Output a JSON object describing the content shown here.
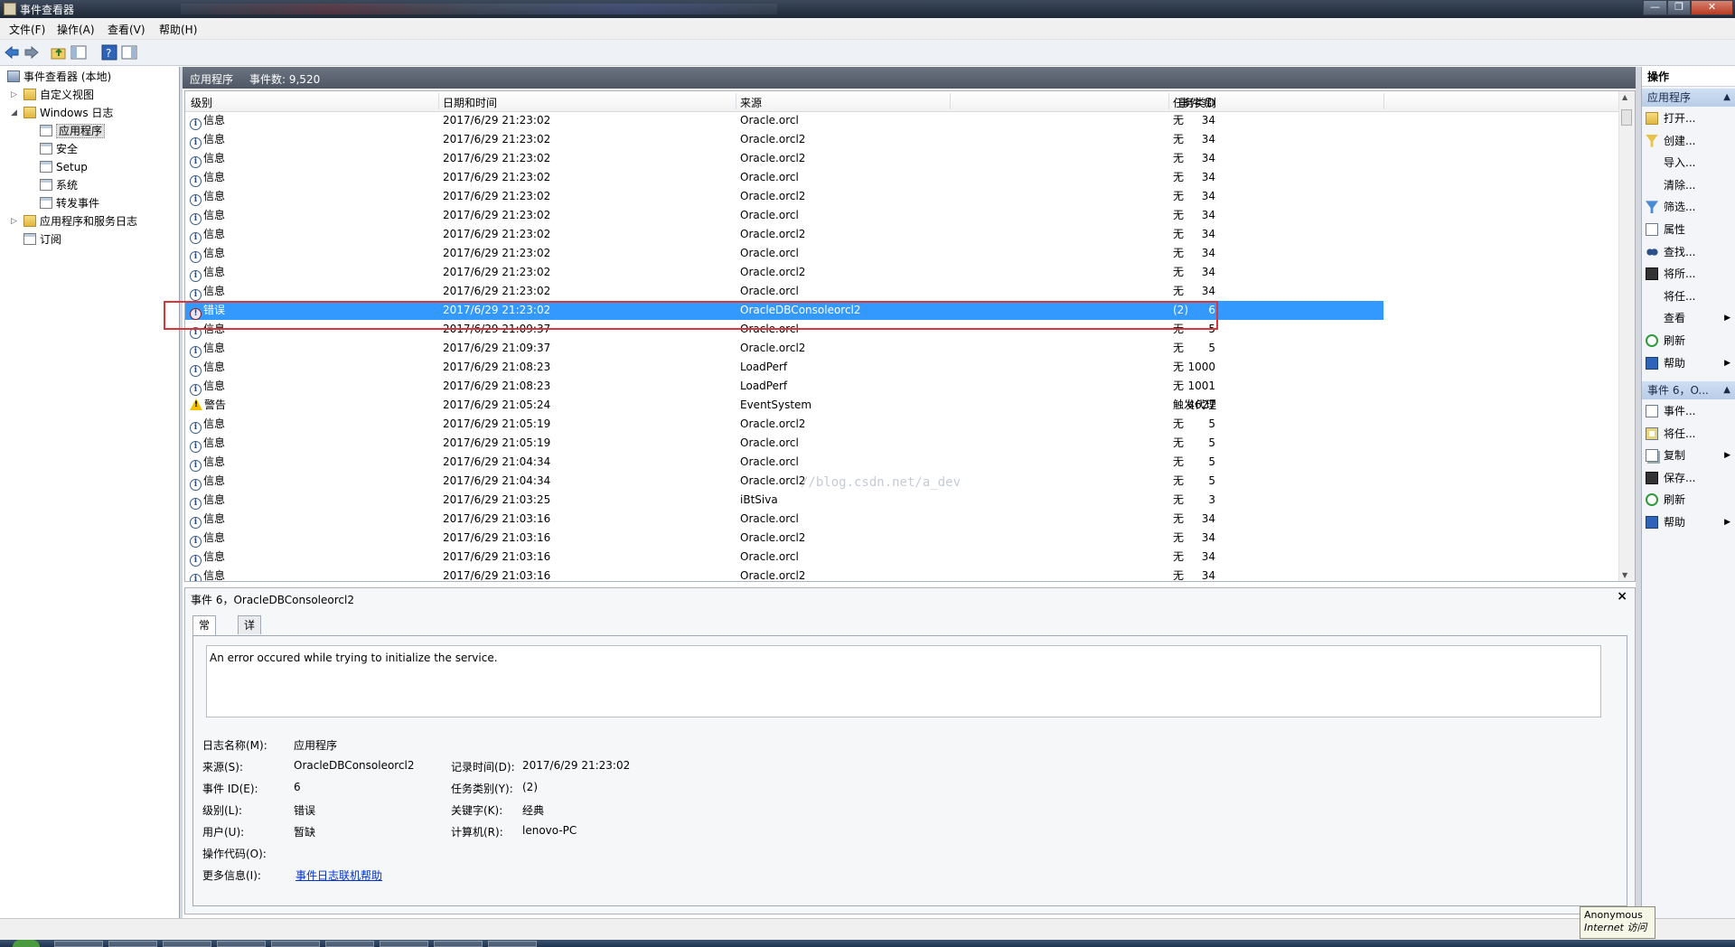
{
  "window": {
    "title": "事件查看器",
    "close_glyph": "✕",
    "min_glyph": "—",
    "max_glyph": "❐"
  },
  "menu": [
    "文件(F)",
    "操作(A)",
    "查看(V)",
    "帮助(H)"
  ],
  "tree": {
    "root": "事件查看器 (本地)",
    "custom_views": "自定义视图",
    "windows_logs": "Windows 日志",
    "windows_logs_children": [
      "应用程序",
      "安全",
      "Setup",
      "系统",
      "转发事件"
    ],
    "app_service_logs": "应用程序和服务日志",
    "subscriptions": "订阅"
  },
  "center_header": {
    "title": "应用程序",
    "count_label": "事件数: 9,520"
  },
  "columns": {
    "level": "级别",
    "datetime": "日期和时间",
    "source": "来源",
    "event_id": "事件 ID",
    "task": "任务类别"
  },
  "events": [
    {
      "level": "信息",
      "type": "info",
      "datetime": "2017/6/29 21:23:02",
      "source": "Oracle.orcl",
      "id": "34",
      "task": "无"
    },
    {
      "level": "信息",
      "type": "info",
      "datetime": "2017/6/29 21:23:02",
      "source": "Oracle.orcl2",
      "id": "34",
      "task": "无"
    },
    {
      "level": "信息",
      "type": "info",
      "datetime": "2017/6/29 21:23:02",
      "source": "Oracle.orcl2",
      "id": "34",
      "task": "无"
    },
    {
      "level": "信息",
      "type": "info",
      "datetime": "2017/6/29 21:23:02",
      "source": "Oracle.orcl",
      "id": "34",
      "task": "无"
    },
    {
      "level": "信息",
      "type": "info",
      "datetime": "2017/6/29 21:23:02",
      "source": "Oracle.orcl2",
      "id": "34",
      "task": "无"
    },
    {
      "level": "信息",
      "type": "info",
      "datetime": "2017/6/29 21:23:02",
      "source": "Oracle.orcl",
      "id": "34",
      "task": "无"
    },
    {
      "level": "信息",
      "type": "info",
      "datetime": "2017/6/29 21:23:02",
      "source": "Oracle.orcl2",
      "id": "34",
      "task": "无"
    },
    {
      "level": "信息",
      "type": "info",
      "datetime": "2017/6/29 21:23:02",
      "source": "Oracle.orcl",
      "id": "34",
      "task": "无"
    },
    {
      "level": "信息",
      "type": "info",
      "datetime": "2017/6/29 21:23:02",
      "source": "Oracle.orcl2",
      "id": "34",
      "task": "无"
    },
    {
      "level": "信息",
      "type": "info",
      "datetime": "2017/6/29 21:23:02",
      "source": "Oracle.orcl",
      "id": "34",
      "task": "无"
    },
    {
      "level": "错误",
      "type": "error",
      "datetime": "2017/6/29 21:23:02",
      "source": "OracleDBConsoleorcl2",
      "id": "6",
      "task": "(2)",
      "selected": true
    },
    {
      "level": "信息",
      "type": "info",
      "datetime": "2017/6/29 21:09:37",
      "source": "Oracle.orcl",
      "id": "5",
      "task": "无"
    },
    {
      "level": "信息",
      "type": "info",
      "datetime": "2017/6/29 21:09:37",
      "source": "Oracle.orcl2",
      "id": "5",
      "task": "无"
    },
    {
      "level": "信息",
      "type": "info",
      "datetime": "2017/6/29 21:08:23",
      "source": "LoadPerf",
      "id": "1000",
      "task": "无"
    },
    {
      "level": "信息",
      "type": "info",
      "datetime": "2017/6/29 21:08:23",
      "source": "LoadPerf",
      "id": "1001",
      "task": "无"
    },
    {
      "level": "警告",
      "type": "warning",
      "datetime": "2017/6/29 21:05:24",
      "source": "EventSystem",
      "id": "4627",
      "task": "触发代理"
    },
    {
      "level": "信息",
      "type": "info",
      "datetime": "2017/6/29 21:05:19",
      "source": "Oracle.orcl2",
      "id": "5",
      "task": "无"
    },
    {
      "level": "信息",
      "type": "info",
      "datetime": "2017/6/29 21:05:19",
      "source": "Oracle.orcl",
      "id": "5",
      "task": "无"
    },
    {
      "level": "信息",
      "type": "info",
      "datetime": "2017/6/29 21:04:34",
      "source": "Oracle.orcl",
      "id": "5",
      "task": "无"
    },
    {
      "level": "信息",
      "type": "info",
      "datetime": "2017/6/29 21:04:34",
      "source": "Oracle.orcl2",
      "id": "5",
      "task": "无"
    },
    {
      "level": "信息",
      "type": "info",
      "datetime": "2017/6/29 21:03:25",
      "source": "iBtSiva",
      "id": "3",
      "task": "无"
    },
    {
      "level": "信息",
      "type": "info",
      "datetime": "2017/6/29 21:03:16",
      "source": "Oracle.orcl",
      "id": "34",
      "task": "无"
    },
    {
      "level": "信息",
      "type": "info",
      "datetime": "2017/6/29 21:03:16",
      "source": "Oracle.orcl2",
      "id": "34",
      "task": "无"
    },
    {
      "level": "信息",
      "type": "info",
      "datetime": "2017/6/29 21:03:16",
      "source": "Oracle.orcl",
      "id": "34",
      "task": "无"
    },
    {
      "level": "信息",
      "type": "info",
      "datetime": "2017/6/29 21:03:16",
      "source": "Oracle.orcl2",
      "id": "34",
      "task": "无"
    }
  ],
  "watermark": "//blog.csdn.net/a_dev",
  "detail": {
    "title": "事件 6，OracleDBConsoleorcl2",
    "close": "×",
    "tabs": [
      "常规",
      "详细信息"
    ],
    "message": "An error occured while trying to initialize the service.",
    "labels": {
      "log_name": "日志名称(M):",
      "source": "来源(S):",
      "event_id": "事件 ID(E):",
      "level": "级别(L):",
      "user": "用户(U):",
      "opcode": "操作代码(O):",
      "more_info": "更多信息(I):",
      "logged": "记录时间(D):",
      "task": "任务类别(Y):",
      "keywords": "关键字(K):",
      "computer": "计算机(R):"
    },
    "values": {
      "log_name": "应用程序",
      "source": "OracleDBConsoleorcl2",
      "event_id": "6",
      "level": "错误",
      "user": "暂缺",
      "opcode": "",
      "more_info": "事件日志联机帮助",
      "logged": "2017/6/29 21:23:02",
      "task": "(2)",
      "keywords": "经典",
      "computer": "lenovo-PC"
    }
  },
  "actions": {
    "title": "操作",
    "group1": "应用程序",
    "group1_items": [
      "打开...",
      "创建...",
      "导入...",
      "清除...",
      "筛选...",
      "属性",
      "查找...",
      "将所...",
      "将任...",
      "查看",
      "刷新",
      "帮助"
    ],
    "group2": "事件 6，O...",
    "group2_items": [
      "事件...",
      "将任...",
      "复制",
      "保存...",
      "刷新",
      "帮助"
    ]
  },
  "tooltip": {
    "line1": "Anonymous",
    "line2": "Internet 访问"
  }
}
